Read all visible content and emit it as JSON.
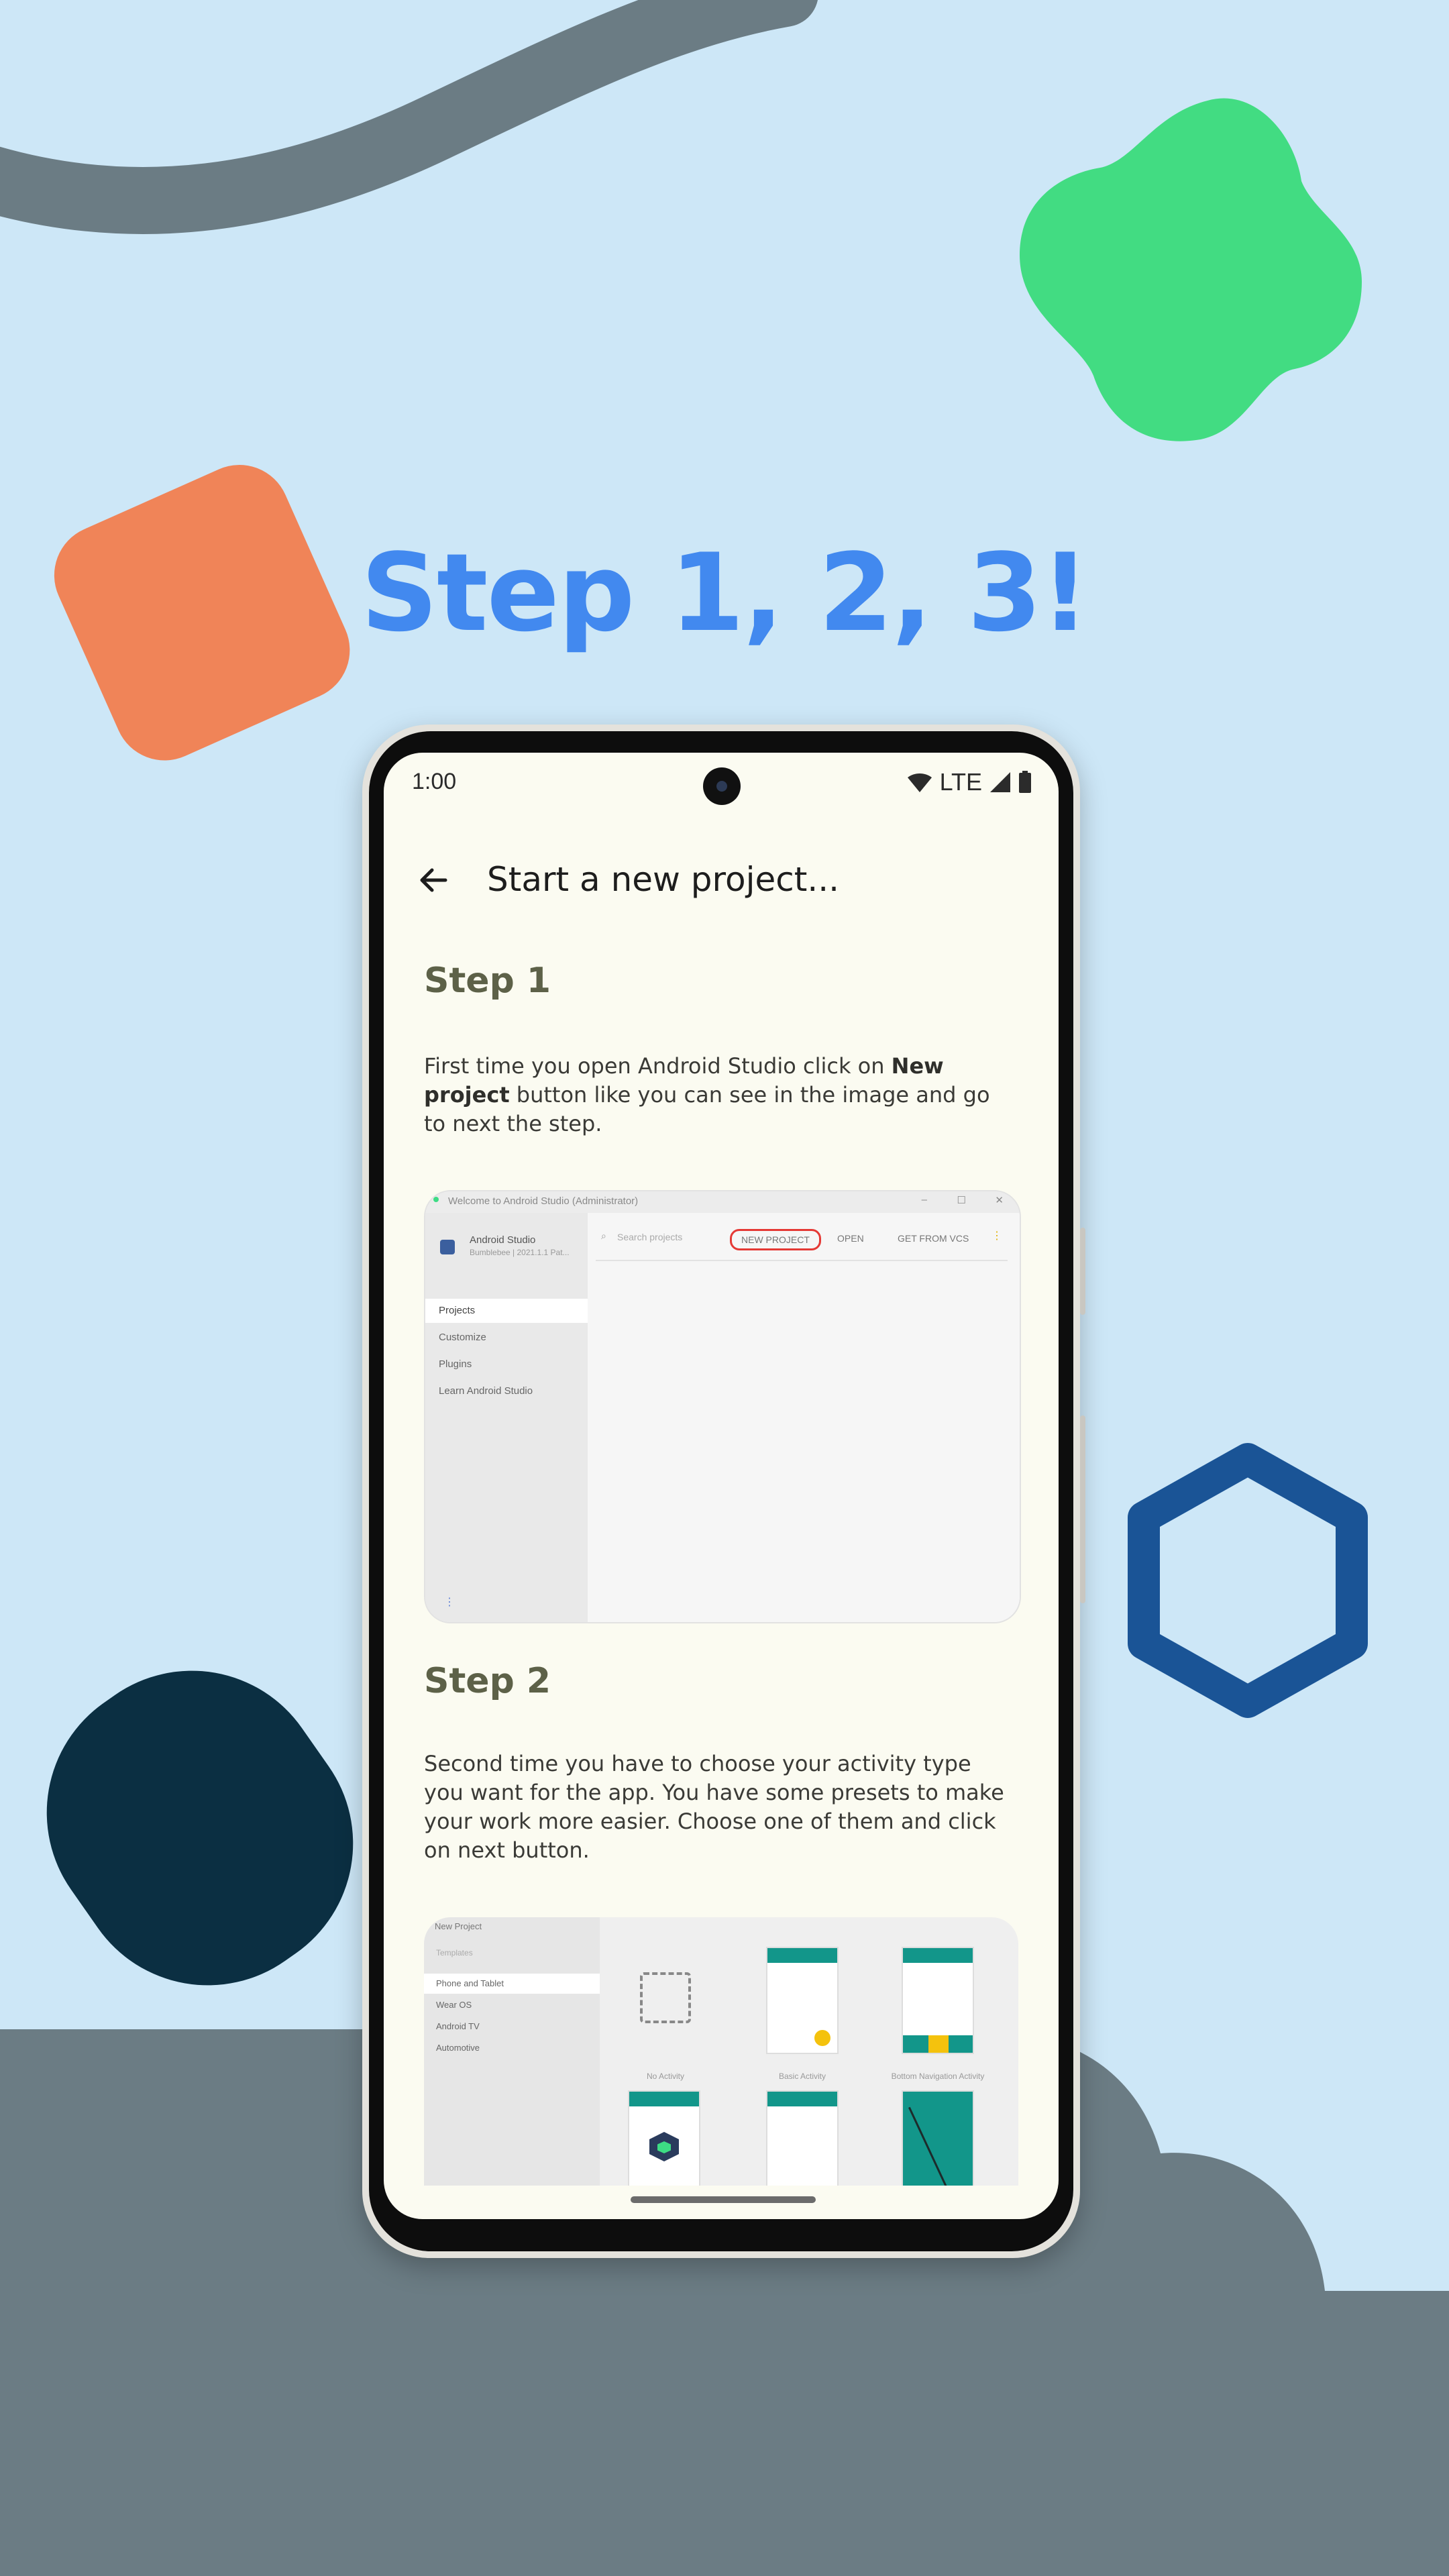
{
  "promo": {
    "headline": "Step 1, 2, 3!",
    "colors": {
      "background": "#cde7f7",
      "headline": "#4289ef",
      "ground": "#6b7c84",
      "green_blob": "#42dc82",
      "orange_square": "#f08458",
      "blue_hexagon": "#1a5496",
      "navy_pill": "#0b2f42"
    }
  },
  "phone": {
    "status_bar": {
      "time": "1:00",
      "network": "LTE",
      "icons": [
        "wifi-icon",
        "signal-icon",
        "battery-icon"
      ]
    },
    "app_bar": {
      "back_icon": "arrow-back-icon",
      "title": "Start a new project..."
    },
    "steps": [
      {
        "title": "Step 1",
        "text_before": "First time you open Android Studio click on ",
        "text_bold": "New project",
        "text_after": " button like you can see in the image and go to next the step.",
        "screenshot": {
          "window_title": "Welcome to Android Studio (Administrator)",
          "app_name": "Android Studio",
          "app_version": "Bumblebee | 2021.1.1 Pat...",
          "search_placeholder": "Search projects",
          "toolbar_buttons": [
            "NEW PROJECT",
            "OPEN",
            "GET FROM VCS"
          ],
          "sidebar_items": [
            "Projects",
            "Customize",
            "Plugins",
            "Learn Android Studio"
          ],
          "selected_item": "Projects"
        }
      },
      {
        "title": "Step 2",
        "text": "Second time you have to choose your activity type you want for the app. You have some presets to make your work more easier. Choose one of them and click on next button.",
        "screenshot": {
          "window_title": "New Project",
          "templates_label": "Templates",
          "categories": [
            "Phone and Tablet",
            "Wear OS",
            "Android TV",
            "Automotive"
          ],
          "selected_category": "Phone and Tablet",
          "template_names": [
            "No Activity",
            "Basic Activity",
            "Bottom Navigation Activity"
          ],
          "accent": "#12968a"
        }
      }
    ]
  }
}
